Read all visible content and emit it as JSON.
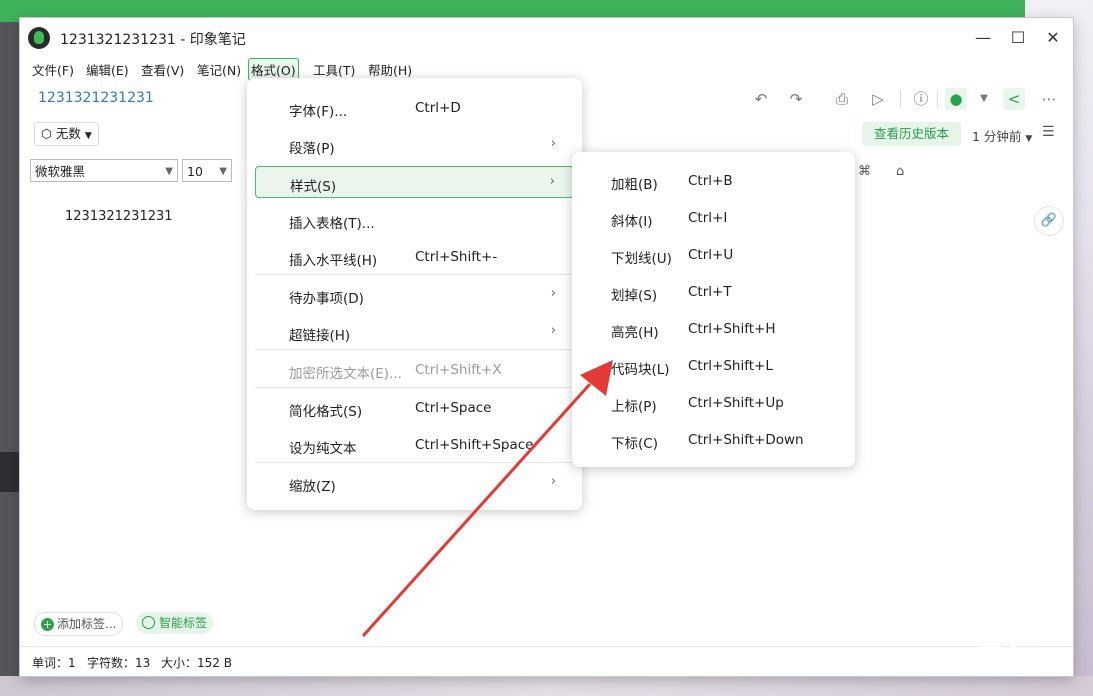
{
  "window": {
    "title": "1231321231231 - 印象笔记",
    "minimize": "—",
    "maximize": "☐",
    "close": "✕"
  },
  "menubar": [
    "文件(F)",
    "编辑(E)",
    "查看(V)",
    "笔记(N)",
    "格式(O)",
    "工具(T)",
    "帮助(H)"
  ],
  "note": {
    "title": "1231321231231",
    "body": "1231321231231"
  },
  "toolbar": {
    "notebook": "无数",
    "history": "查看历史版本",
    "time": "1 分钟前"
  },
  "format_bar": {
    "font": "微软雅黑",
    "size": "10"
  },
  "tags": {
    "add": "添加标签...",
    "smart": "智能标签"
  },
  "status": {
    "words": "单词：1",
    "chars": "字符数：13",
    "size": "大小：152 B"
  },
  "format_menu": {
    "items": [
      {
        "label": "字体(F)...",
        "shortcut": "Ctrl+D"
      },
      {
        "label": "段落(P)",
        "shortcut": ""
      },
      {
        "label": "样式(S)",
        "shortcut": ""
      },
      {
        "label": "插入表格(T)...",
        "shortcut": ""
      },
      {
        "label": "插入水平线(H)",
        "shortcut": "Ctrl+Shift+-"
      },
      {
        "label": "待办事项(D)",
        "shortcut": ""
      },
      {
        "label": "超链接(H)",
        "shortcut": ""
      },
      {
        "label": "加密所选文本(E)...",
        "shortcut": "Ctrl+Shift+X"
      },
      {
        "label": "简化格式(S)",
        "shortcut": "Ctrl+Space"
      },
      {
        "label": "设为纯文本",
        "shortcut": "Ctrl+Shift+Space"
      },
      {
        "label": "缩放(Z)",
        "shortcut": ""
      }
    ]
  },
  "style_submenu": {
    "items": [
      {
        "label": "加粗(B)",
        "shortcut": "Ctrl+B"
      },
      {
        "label": "斜体(I)",
        "shortcut": "Ctrl+I"
      },
      {
        "label": "下划线(U)",
        "shortcut": "Ctrl+U"
      },
      {
        "label": "划掉(S)",
        "shortcut": "Ctrl+T"
      },
      {
        "label": "高亮(H)",
        "shortcut": "Ctrl+Shift+H"
      },
      {
        "label": "代码块(L)",
        "shortcut": "Ctrl+Shift+L"
      },
      {
        "label": "上标(P)",
        "shortcut": "Ctrl+Shift+Up"
      },
      {
        "label": "下标(C)",
        "shortcut": "Ctrl+Shift+Down"
      }
    ]
  },
  "watermark": {
    "brand": "Baidu经验",
    "url": "jingyan.baidu.com"
  },
  "colors": {
    "accent": "#2aa34a",
    "annotation_arrow": "#e53935",
    "highlight_bg": "#eaf6ed"
  }
}
